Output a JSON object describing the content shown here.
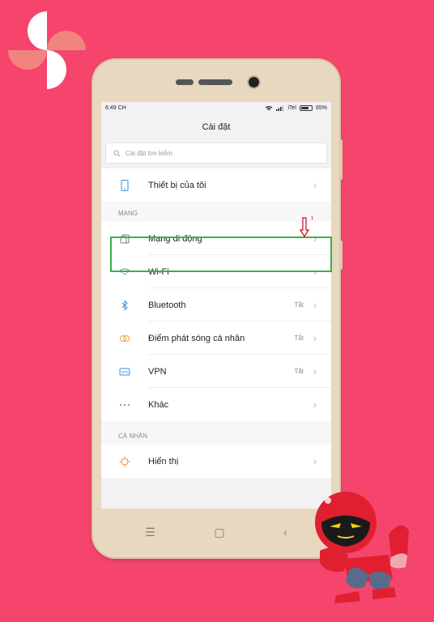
{
  "status": {
    "time": "6:49 CH",
    "carrier": "iTel",
    "battery": "65%"
  },
  "title": "Cài đặt",
  "search": {
    "placeholder": "Cài đặt tìm kiếm"
  },
  "device_item": {
    "label": "Thiết bị của tôi"
  },
  "section_network": {
    "header": "MẠNG",
    "items": [
      {
        "label": "Mạng di động",
        "value": "",
        "icon": "sim-icon"
      },
      {
        "label": "Wi-Fi",
        "value": "",
        "icon": "wifi-icon"
      },
      {
        "label": "Bluetooth",
        "value": "Tắt",
        "icon": "bluetooth-icon"
      },
      {
        "label": "Điểm phát sóng cá nhân",
        "value": "Tắt",
        "icon": "hotspot-icon"
      },
      {
        "label": "VPN",
        "value": "Tắt",
        "icon": "vpn-icon"
      },
      {
        "label": "Khác",
        "value": "",
        "icon": "more-dots-icon"
      }
    ]
  },
  "section_personal": {
    "header": "CÁ NHÂN",
    "items": [
      {
        "label": "Hiển thị",
        "value": "",
        "icon": "display-icon"
      }
    ]
  },
  "annotation": {
    "number": "1"
  },
  "colors": {
    "background": "#f5456c",
    "highlight": "#3cb043",
    "arrow": "#d0021b",
    "phone_body": "#e7d8bf"
  }
}
